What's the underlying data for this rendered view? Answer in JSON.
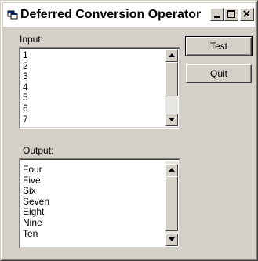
{
  "window": {
    "title": "Deferred Conversion Operator",
    "icon": "app-window-icon",
    "caption_buttons": [
      "minimize-icon",
      "maximize-icon",
      "close-icon"
    ]
  },
  "input": {
    "label": "Input:",
    "items": [
      "1",
      "2",
      "3",
      "4",
      "5",
      "6",
      "7"
    ]
  },
  "output": {
    "label": "Output:",
    "items": [
      "Four",
      "Five",
      "Six",
      "Seven",
      "Eight",
      "Nine",
      "Ten"
    ]
  },
  "buttons": {
    "test_label": "Test",
    "quit_label": "Quit"
  }
}
